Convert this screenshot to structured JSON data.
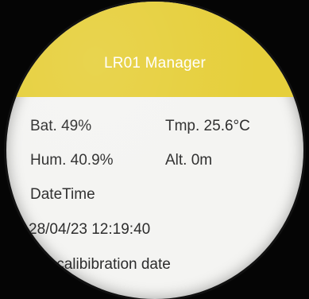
{
  "app": {
    "title": "LR01 Manager"
  },
  "readings": {
    "battery": "Bat. 49%",
    "temperature": "Tmp. 25.6°C",
    "humidity": "Hum. 40.9%",
    "altitude": "Alt. 0m"
  },
  "datetime": {
    "label": "DateTime",
    "value": "28/04/23 12:19:40"
  },
  "calibration": {
    "label": "Last calibibration date"
  },
  "colors": {
    "title_bar": "#e6cf3b",
    "title_text": "#ffffff",
    "body_background": "#f4f4f2",
    "body_text": "#2c2c2c"
  }
}
